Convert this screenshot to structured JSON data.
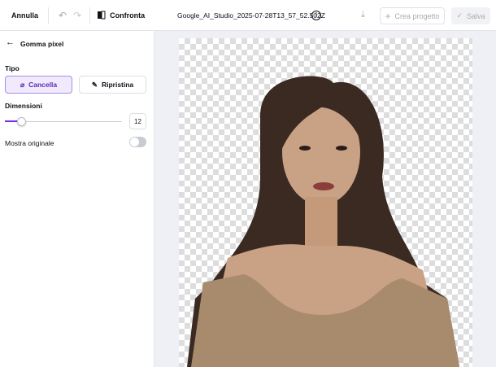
{
  "topbar": {
    "cancel": "Annulla",
    "compare": "Confronta",
    "filename": "Google_AI_Studio_2025-07-28T13_57_52.502Z",
    "create_project": "Crea progetto",
    "save": "Salva"
  },
  "panel": {
    "title": "Gomma pixel",
    "type_label": "Tipo",
    "erase": "Cancella",
    "restore": "Ripristina",
    "size_label": "Dimensioni",
    "size_value": "12",
    "size_fraction": 0.14,
    "show_original": "Mostra originale",
    "show_original_on": false
  },
  "colors": {
    "accent": "#7d2ae8",
    "selected_bg": "#f1eafd"
  }
}
